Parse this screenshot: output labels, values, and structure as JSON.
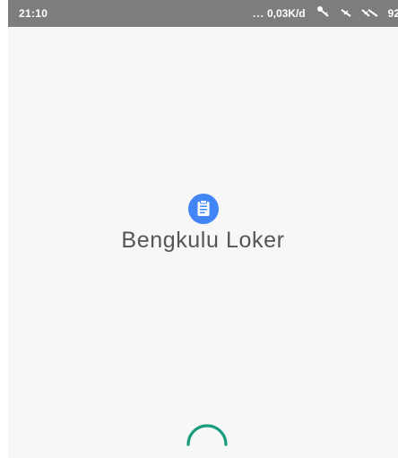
{
  "status_bar": {
    "time": "21:10",
    "dots": "...",
    "network_speed": "0,03K/d",
    "battery_level": "92",
    "icons": [
      "key-icon",
      "signal-muted-icon",
      "signal-strength-icon"
    ]
  },
  "splash": {
    "app_name": "Bengkulu Loker",
    "icon": "clipboard-icon",
    "icon_color": "#4285f4"
  },
  "loader": {
    "icon": "loading-spinner-icon",
    "color": "#1a9e7f"
  }
}
